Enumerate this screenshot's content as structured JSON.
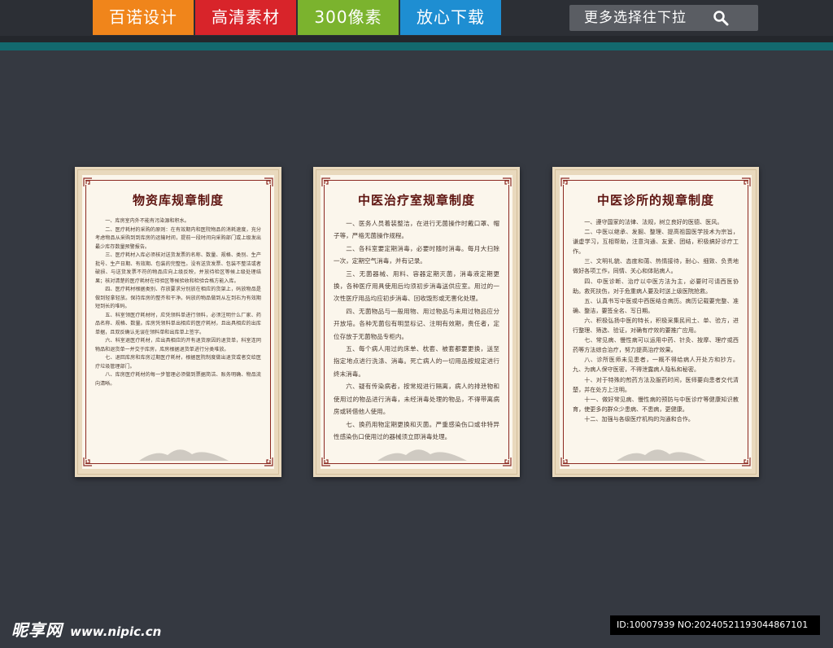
{
  "top_tags": [
    {
      "label": "百诺设计",
      "color": "#f0851b"
    },
    {
      "label": "高清素材",
      "color": "#d8242a"
    },
    {
      "label": "300像素",
      "color": "#7bb32e"
    },
    {
      "label": "放心下载",
      "color": "#1e8ed2"
    }
  ],
  "search": {
    "text": "更多选择往下拉",
    "icon": "search-icon"
  },
  "accent_teal": "#13696e",
  "boards": [
    {
      "title": "物资库规章制度",
      "paragraphs": [
        "一、库房室内外不能有污染源和积水。",
        "二、医疗耗材的采购的原则：在有效期内和医院物品的消耗速度，充分考虑物品从采购到到库房的运输时间，提前一段时间向采购部门或上级发出最少库存数量预警报告。",
        "三、医疗耗材入库必须核对送货发票的名称、数量、规格、类别、生产批号、生产日期、有效期、包装的完整性。没有送货发票、包装不整洁或者破损、与送货发票不符的物品应向上级反映，并放待检区等候上级处理结果；核对清楚的医疗耗材在待验区等候验收和检验合格方能入库。",
        "四、医疗耗材根据类别、存放要求分别放在相应的货架上，码放物品是做到轻拿轻放。保持库房的整齐和干净。码放的物品做到从左到右为有效期短到长的堆码。",
        "五、科室领医疗耗材时，应凭领料单进行领料，必须注明什么厂家、药品名称、规格、数量。库房凭领料单出相应的医疗耗材，且出具相应的出库单据，且双反确认无误在领料单和出库单上签字。",
        "六、科室退医疗耗材，应出具相应的开有退货原因的退货单，科室连同物品和退货单一并交于库房，库房根据退货单进行分类堆放。",
        "七、退回库房和库房过期医疗耗材，根据医院制度做出退货或者交给医疗垃圾管理部门。",
        "八、库房医疗耗材的每一步管理必须做到票据简洁、账务明确、物品流向清晰。"
      ]
    },
    {
      "title": "中医治疗室规章制度",
      "paragraphs": [
        "一、医务人员着装整洁，在进行无菌操作时戴口罩、帽子等，严格无菌操作规程。",
        "二、各科室要定期消毒，必要时随时消毒。每月大扫除一次，定期空气消毒，并有记录。",
        "三、无菌器械、用料、容器定期灭菌，消毒液定期更换，各种医疗用具使用后均须初步消毒送供应室。用过的一次性医疗用品均应初步消毒、回收毁形或无害化处理。",
        "四、无菌物品与一般用物、用过物品与未用过物品应分开放培。各种无菌包有明显标记、注明有效期，责任者，定位存放于无菌物品专柜内。",
        "五、每个病人用过的床单、枕套、被套都要更换，送至指定地点进行洗涤、消毒。死亡病人的一切用品按规定进行终末消毒。",
        "六、疑有传染病者，按常规进行隔离，病人的排泄物和使用过的物品进行消毒，未经消毒处理的物品，不得带离病房或转借他人使用。",
        "七、换药用物定期更换和灭菌。严重感染伤口或非特异性感染伤口使用过的器械须立即消毒处理。"
      ]
    },
    {
      "title": "中医诊所的规章制度",
      "paragraphs": [
        "一、遵守国家的法律、法规，树立良好的医德、医风。",
        "二、中医以继承、发掘、整理、提高祖国医学技术为宗旨，谦虚学习，互相帮助，注意沟通、友爱、团结，积极搞好诊疗工作。",
        "三、文明礼貌、态度和蔼、热情接待，耐心、细致、负责地做好各项工作，同情、关心和体贴病人。",
        "四、中医诊断、治疗以中医方法为主，必要时可请西医协助。救死扶伤，对于危重病人要及时送上级医院抢救。",
        "五、认真书写中医或中西医结合病历。病历记载要完整、准确、整洁，要签全名、写日期。",
        "六、积极弘扬中医的特长，积极采集民间土、单、验方，进行整理、筛选、验证，对确有疗效的要推广应用。",
        "七、常见病、慢性病可以运用中药、针灸、按摩、理疗或西药等方法综合治疗，努力提高治疗效果。",
        "八、诊所医师未见患者，一概不得给病人开处方和抄方。九、为病人保守医密，不得泄露病人隐私和秘密。",
        "十、对于特殊的煎药方法及服药时间，医师要向患者交代清楚，并在处方上注明。",
        "十一、做好常见病、慢性病的预防与中医诊疗等健康知识教育，使更多的群众少患病、不患病，更健康。",
        "十二、加强与各级医疗机构的沟通和合作。"
      ]
    }
  ],
  "watermark": {
    "logo": "昵享网",
    "url": "www.nipic.cn"
  },
  "image_id": "ID:10007939 NO:20240521193044867101"
}
